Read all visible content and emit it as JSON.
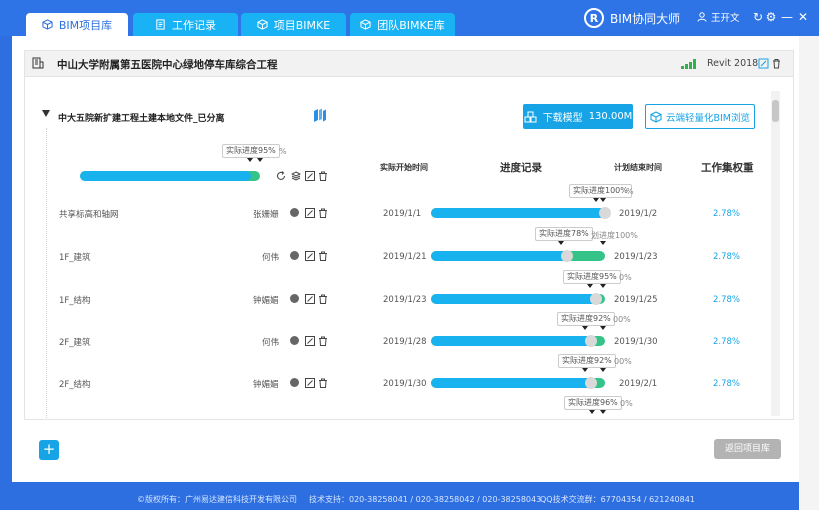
{
  "app": {
    "brand": "BIM协同大师",
    "brand_logo": "R",
    "user": "王开文",
    "refresh_glyph": "↻",
    "settings_glyph": "⚙",
    "minimize_glyph": "—",
    "close_glyph": "✕"
  },
  "tabs": [
    {
      "label": "BIM项目库",
      "active": true
    },
    {
      "label": "工作记录",
      "active": false
    },
    {
      "label": "项目BIMKE",
      "active": false
    },
    {
      "label": "团队BIMKE库",
      "active": false
    }
  ],
  "project": {
    "title": "中山大学附属第五医院中心绿地停车库综合工程",
    "revit": "Revit 2018"
  },
  "folder": {
    "title": "中大五院新扩建工程土建本地文件_已分离",
    "download_label": "下载模型",
    "download_size": "130.00M",
    "cloud_label": "云端轻量化BIM浏览",
    "summary_tooltip": "实际进度95%",
    "summary_ghost": "%",
    "summary_progress": 95
  },
  "columns": {
    "start": "实际开始时间",
    "progress": "进度记录",
    "end": "计划结束时间",
    "weight": "工作集权重"
  },
  "rows": [
    {
      "name": "共享标高和轴网",
      "user": "张姗姗",
      "start": "2019/1/1",
      "end": "2019/1/2",
      "weight": "2.78%",
      "progress": 100,
      "tooltip": "实际进度100%",
      "ghost": "%"
    },
    {
      "name": "1F_建筑",
      "user": "何伟",
      "start": "2019/1/21",
      "end": "2019/1/23",
      "weight": "2.78%",
      "progress": 78,
      "tooltip": "实际进度78%",
      "ghost": "划进度100%"
    },
    {
      "name": "1F_结构",
      "user": "钟媚媚",
      "start": "2019/1/23",
      "end": "2019/1/25",
      "weight": "2.78%",
      "progress": 95,
      "tooltip": "实际进度95%",
      "ghost": "0%"
    },
    {
      "name": "2F_建筑",
      "user": "何伟",
      "start": "2019/1/28",
      "end": "2019/1/30",
      "weight": "2.78%",
      "progress": 92,
      "tooltip": "实际进度92%",
      "ghost": "00%"
    },
    {
      "name": "2F_结构",
      "user": "钟媚媚",
      "start": "2019/1/30",
      "end": "2019/2/1",
      "weight": "2.78%",
      "progress": 92,
      "tooltip": "实际进度92%",
      "ghost": "00%"
    }
  ],
  "last_tooltip": {
    "tooltip": "实际进度96%",
    "ghost": "0%"
  },
  "buttons": {
    "add": "+",
    "back": "返回项目库"
  },
  "footer": {
    "copyright": "©版权所有：广州易达建信科技开发有限公司",
    "support": "技术支持：020-38258041 / 020-38258042 / 020-38258043",
    "qq": "QQ技术交流群：67704354 / 621240841"
  },
  "colors": {
    "accent": "#16a4e6",
    "bar_actual": "#18b2ee",
    "bar_plan": "#35c38a",
    "topbar": "#2e74e6"
  }
}
